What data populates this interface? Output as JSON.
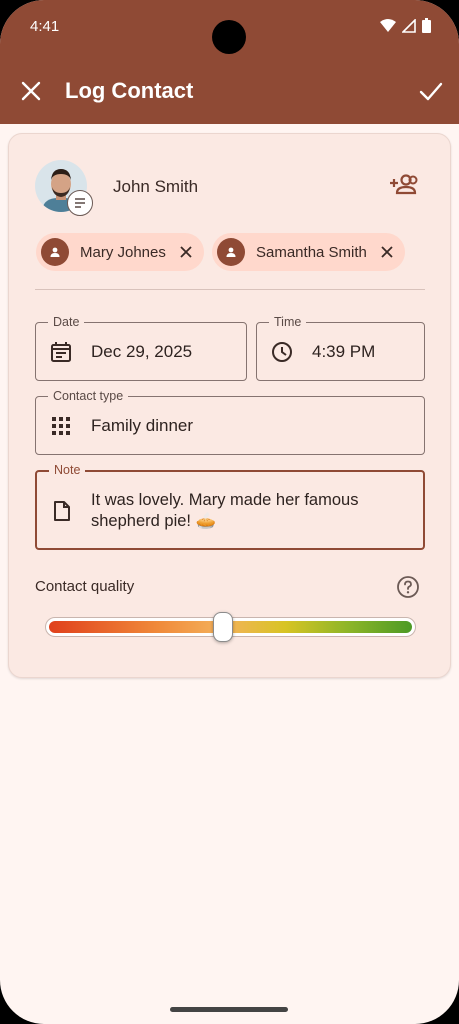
{
  "status": {
    "time": "4:41"
  },
  "toolbar": {
    "title": "Log Contact"
  },
  "contact": {
    "name": "John Smith"
  },
  "chips": [
    {
      "label": "Mary Johnes"
    },
    {
      "label": "Samantha Smith"
    }
  ],
  "date": {
    "label": "Date",
    "value": "Dec 29, 2025"
  },
  "time": {
    "label": "Time",
    "value": "4:39 PM"
  },
  "contact_type": {
    "label": "Contact type",
    "value": "Family dinner"
  },
  "note": {
    "label": "Note",
    "value": "It was lovely. Mary made her famous shepherd pie! 🥧"
  },
  "quality": {
    "label": "Contact quality",
    "value_percent": 48
  },
  "colors": {
    "primary": "#8F4A35",
    "background": "#FFF5F2",
    "card": "#FBE9E3",
    "chip": "#FFD8CC"
  },
  "icons": [
    "close-icon",
    "check-icon",
    "add-person-icon",
    "chat-icon",
    "person-icon",
    "calendar-icon",
    "clock-icon",
    "grid-icon",
    "note-icon",
    "help-icon"
  ]
}
